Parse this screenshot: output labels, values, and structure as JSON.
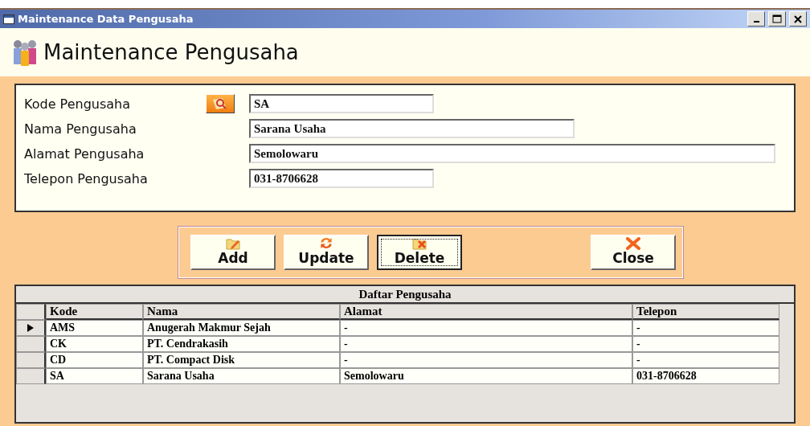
{
  "window": {
    "title": "Maintenance Data Pengusaha"
  },
  "header": {
    "title": "Maintenance Pengusaha"
  },
  "fields": [
    {
      "label": "Kode Pengusaha",
      "value": "SA",
      "lookup_button": true
    },
    {
      "label": "Nama Pengusaha",
      "value": "Sarana Usaha",
      "lookup_button": false
    },
    {
      "label": "Alamat Pengusaha",
      "value": "Semolowaru",
      "lookup_button": false
    },
    {
      "label": "Telepon Pengusaha",
      "value": "031-8706628",
      "lookup_button": false
    }
  ],
  "buttons": [
    {
      "label": "Add",
      "kind": "add",
      "focused": false
    },
    {
      "label": "Update",
      "kind": "update",
      "focused": false
    },
    {
      "label": "Delete",
      "kind": "delete",
      "focused": true
    },
    {
      "label": "Close",
      "kind": "close",
      "focused": false
    }
  ],
  "table": {
    "caption": "Daftar Pengusaha",
    "columns": [
      "Kode",
      "Nama",
      "Alamat",
      "Telepon"
    ],
    "rows": [
      {
        "cells": [
          "AMS",
          "Anugerah Makmur Sejah",
          "-",
          "-"
        ],
        "selected": true
      },
      {
        "cells": [
          "CK",
          "PT. Cendrakasih",
          "-",
          "-"
        ],
        "selected": false
      },
      {
        "cells": [
          "CD",
          "PT. Compact Disk",
          "-",
          "-"
        ],
        "selected": false
      },
      {
        "cells": [
          "SA",
          "Sarana Usaha",
          "Semolowaru",
          "031-8706628"
        ],
        "selected": false
      }
    ]
  }
}
